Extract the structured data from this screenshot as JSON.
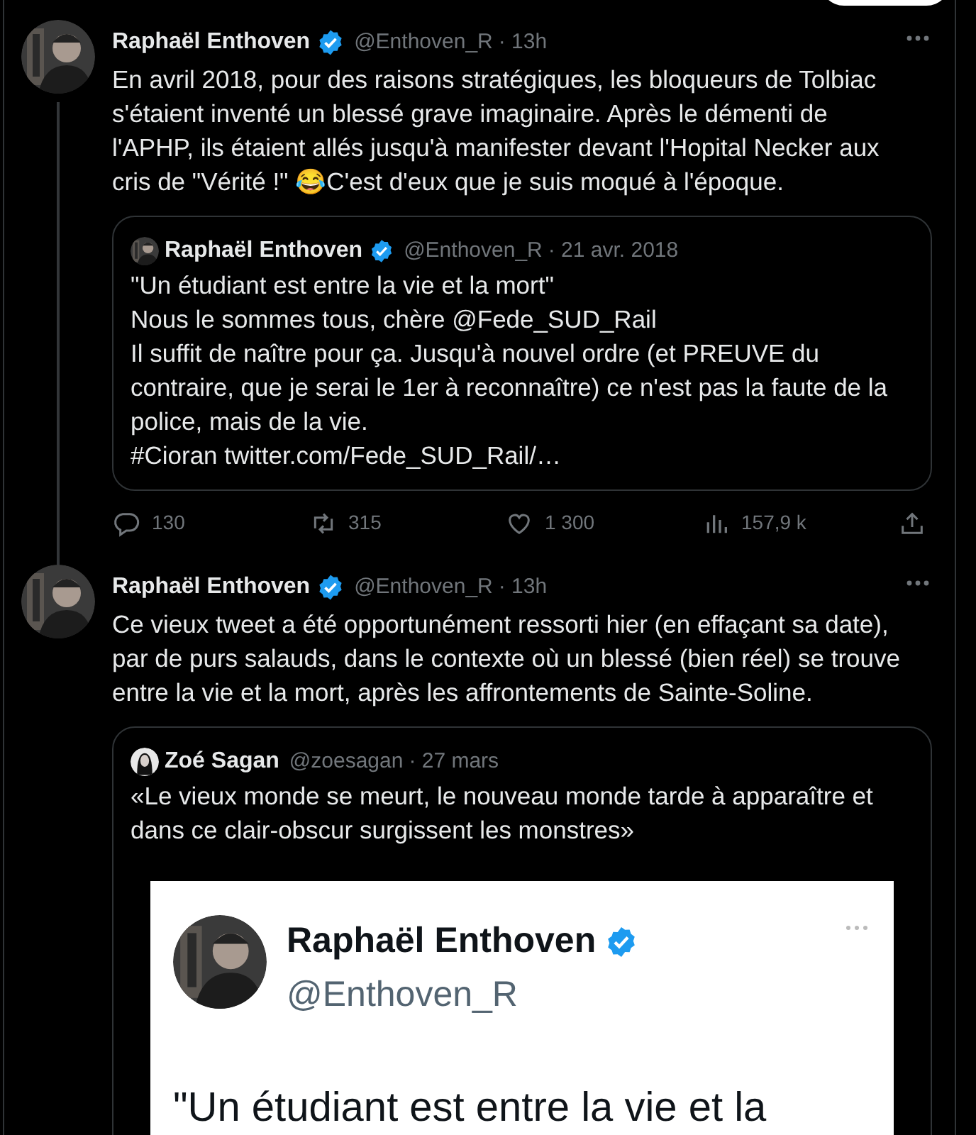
{
  "tweets": [
    {
      "author": "Raphaël Enthoven",
      "verified": true,
      "handle": "@Enthoven_R",
      "time": "· 13h",
      "thread": true,
      "text": "En avril 2018, pour des raisons stratégiques, les bloqueurs de Tolbiac s'étaient inventé un blessé grave imaginaire. Après le démenti de l'APHP, ils étaient allés jusqu'à manifester devant l'Hopital Necker aux cris de \"Vérité !\" 😂C'est d'eux que je suis moqué à l'époque.",
      "quote": {
        "author": "Raphaël Enthoven",
        "verified": true,
        "handle": "@Enthoven_R",
        "time": "· 21 avr. 2018",
        "lines": [
          "\"Un étudiant est entre la vie et la mort\"",
          "Nous le sommes tous, chère @Fede_SUD_Rail",
          "Il suffit de naître pour ça. Jusqu'à nouvel ordre (et PREUVE du contraire, que je serai le 1er à reconnaître) ce n'est pas la faute de la police, mais de la vie.",
          "#Cioran twitter.com/Fede_SUD_Rail/…"
        ]
      },
      "actions": [
        {
          "kind": "reply",
          "count": "130"
        },
        {
          "kind": "retweet",
          "count": "315"
        },
        {
          "kind": "like",
          "count": "1 300"
        },
        {
          "kind": "views",
          "count": "157,9 k"
        },
        {
          "kind": "share"
        }
      ]
    },
    {
      "author": "Raphaël Enthoven",
      "verified": true,
      "handle": "@Enthoven_R",
      "time": "· 13h",
      "thread": false,
      "text": "Ce vieux tweet a été opportunément ressorti hier (en effaçant sa date), par de purs salauds, dans le contexte où un blessé (bien réel) se trouve entre la vie et la mort, après les affrontements de Sainte-Soline.",
      "quote": {
        "author": "Zoé Sagan",
        "verified": false,
        "handle": "@zoesagan",
        "time": "· 27 mars",
        "lines": [
          "«Le vieux monde se meurt, le nouveau monde tarde à apparaître et dans ce clair-obscur surgissent les monstres»"
        ],
        "screenshot": {
          "author": "Raphaël Enthoven",
          "verified": true,
          "handle": "@Enthoven_R",
          "text": "\"Un étudiant est entre la vie et la"
        }
      }
    }
  ]
}
